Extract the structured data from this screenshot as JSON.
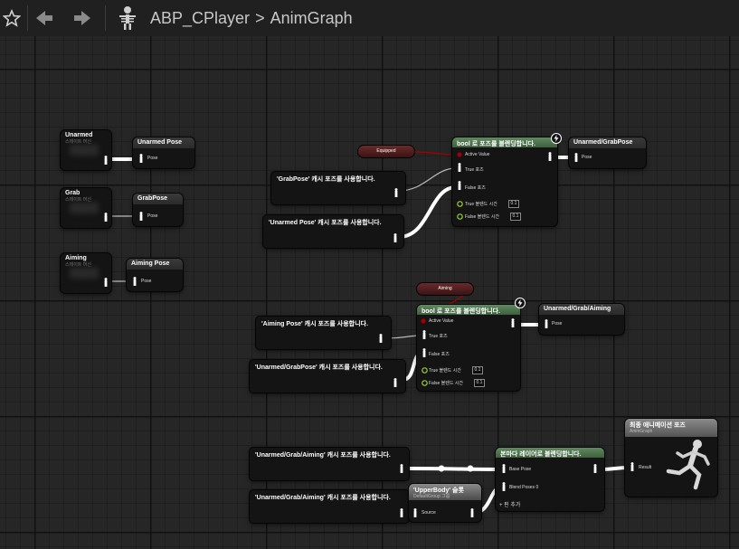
{
  "toolbar": {
    "icons": [
      "star-icon",
      "back-arrow-icon",
      "forward-arrow-icon",
      "skeleton-asset-icon"
    ]
  },
  "breadcrumb": {
    "asset": "ABP_CPlayer",
    "separator": ">",
    "graph": "AnimGraph"
  },
  "nodes": {
    "unarmed_sm": {
      "title": "Unarmed",
      "sub": "스테이트 머신"
    },
    "grab_sm": {
      "title": "Grab",
      "sub": "스테이트 머신"
    },
    "aiming_sm": {
      "title": "Aiming",
      "sub": "스테이트 머신"
    },
    "unarmed_pose": {
      "title": "Unarmed Pose",
      "pin": "Pose"
    },
    "grab_pose": {
      "title": "GrabPose",
      "pin": "Pose"
    },
    "aiming_pose": {
      "title": "Aiming Pose",
      "pin": "Pose"
    },
    "equipped_var": {
      "label": "Equipped"
    },
    "aiming_var": {
      "label": "Aiming"
    },
    "blend1": {
      "title": "bool 로 포즈를 블렌딩합니다.",
      "active": "Active Value",
      "true_pose": "True 포즈",
      "false_pose": "False 포즈",
      "true_blend": "True 블렌드 시간",
      "false_blend": "False 블렌드 시간",
      "true_val": "0.1",
      "false_val": "0.1"
    },
    "blend2": {
      "title": "bool 로 포즈를 블렌딩합니다.",
      "active": "Active Value",
      "true_pose": "True 포즈",
      "false_pose": "False 포즈",
      "true_blend": "True 블렌드 시간",
      "false_blend": "False 블렌드 시간",
      "true_val": "0.1",
      "false_val": "0.1"
    },
    "cache_grabpose": {
      "label": "'GrabPose' 캐시 포즈를 사용합니다."
    },
    "cache_unarmed1": {
      "label": "'Unarmed Pose' 캐시 포즈를 사용합니다."
    },
    "cache_aiming": {
      "label": "'Aiming Pose' 캐시 포즈를 사용합니다."
    },
    "cache_unarmedgrab": {
      "label": "'Unarmed/GrabPose' 캐시 포즈를 사용합니다."
    },
    "cache_uga1": {
      "label": "'Unarmed/Grab/Aiming' 캐시 포즈를 사용합니다."
    },
    "cache_uga2": {
      "label": "'Unarmed/Grab/Aiming' 캐시 포즈를 사용합니다."
    },
    "save_unarmedgrab": {
      "title": "Unarmed/GrabPose",
      "pin": "Pose"
    },
    "save_uga": {
      "title": "Unarmed/Grab/Aiming",
      "pin": "Pose"
    },
    "layered": {
      "title": "본마다 레이어로 블렌딩합니다.",
      "base": "Base Pose",
      "blend0": "Blend Poses 0",
      "add": "핀 추가"
    },
    "slot": {
      "title": "'UpperBody' 슬롯",
      "sub": "DefaultGroup 그룹",
      "pin": "Source"
    },
    "output": {
      "title": "최종 애니메이션 포즈",
      "sub": "AnimGraph",
      "pin": "Result"
    }
  },
  "colors": {
    "exec_white": "#ffffff",
    "bool_red": "#a00000",
    "float_green": "#9acd32",
    "header_green": "#4f7a4f"
  }
}
